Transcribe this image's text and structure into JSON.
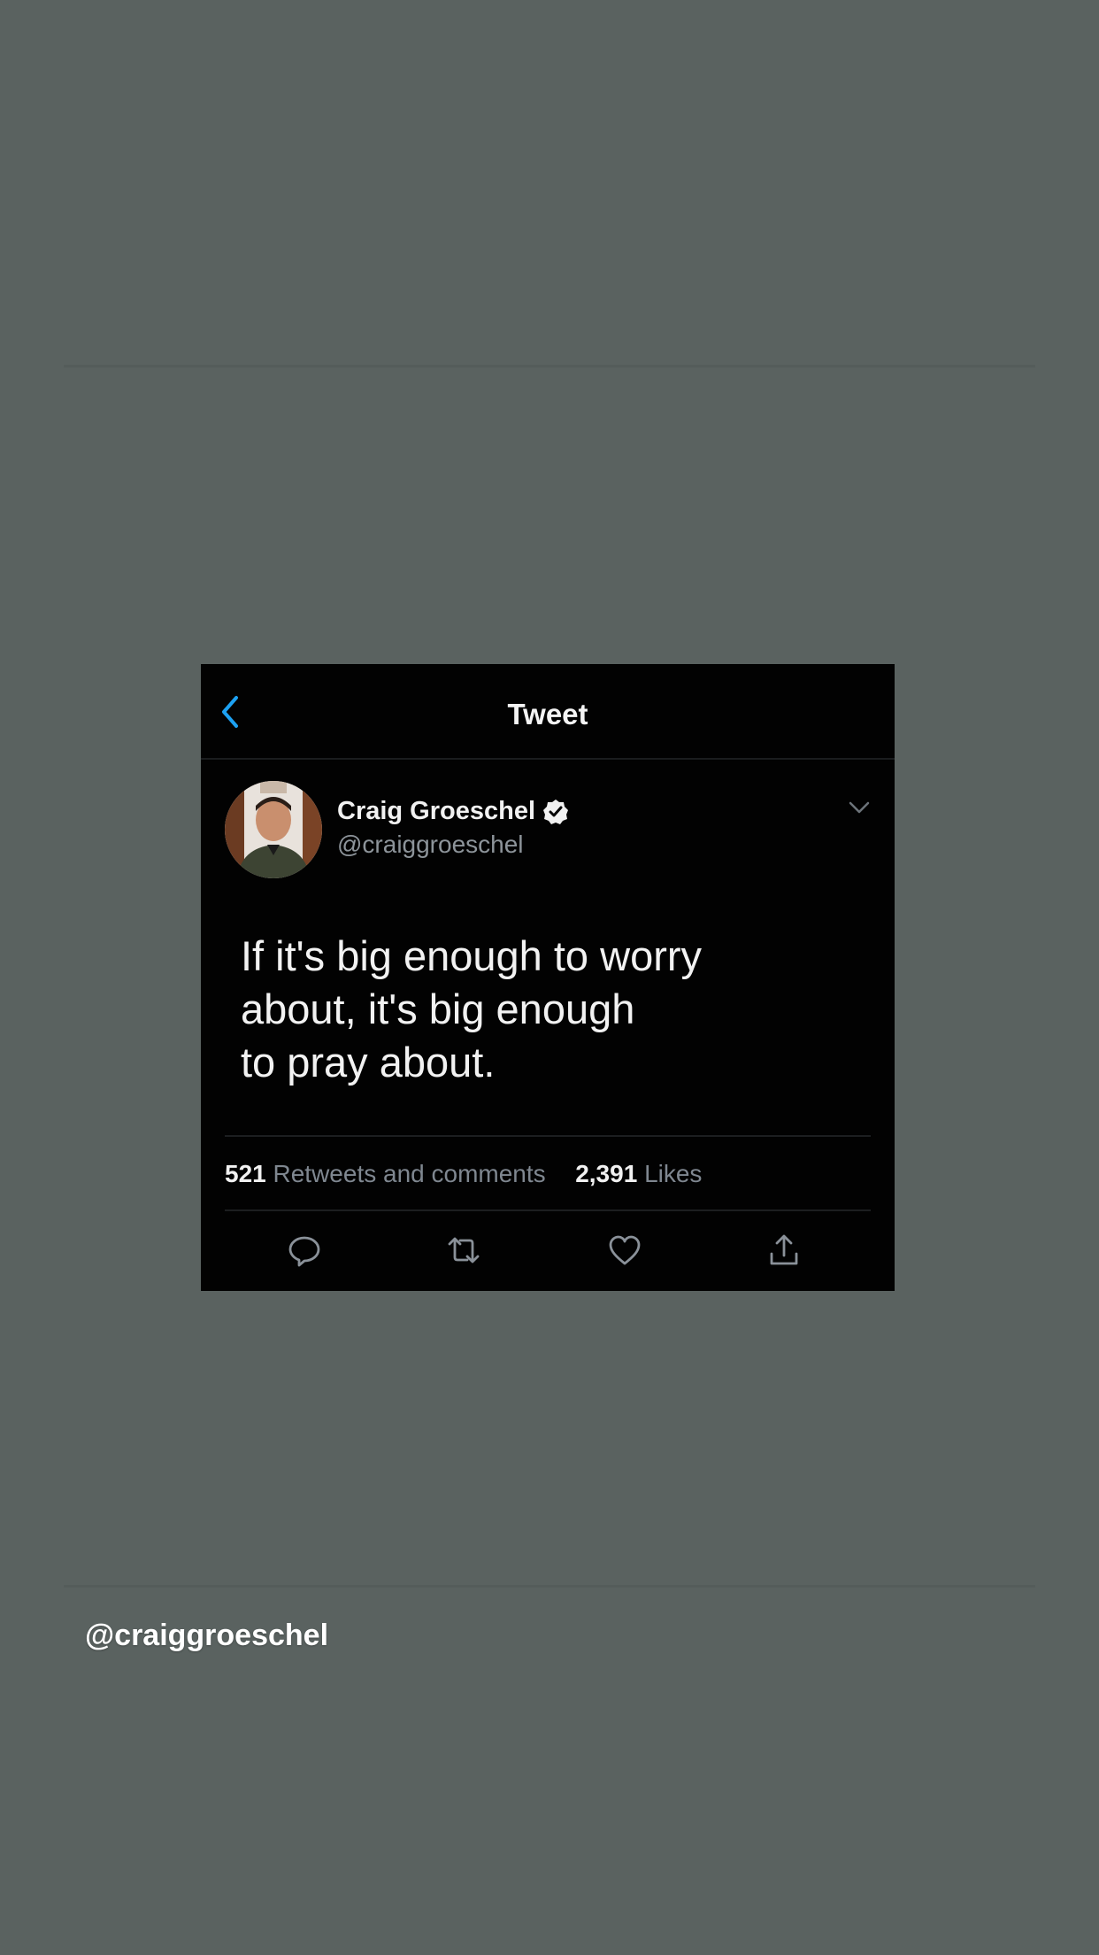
{
  "tweet": {
    "nav_title": "Tweet",
    "author": {
      "name": "Craig Groeschel",
      "handle": "@craiggroeschel",
      "verified": true
    },
    "text_lines": [
      "If it's big enough to worry",
      "about, it's big enough",
      "to pray about."
    ],
    "stats": {
      "retweets_count": "521",
      "retweets_label": "Retweets and comments",
      "likes_count": "2,391",
      "likes_label": "Likes"
    },
    "icons": {
      "back": "chevron-left-icon",
      "verified": "verified-badge-icon",
      "more": "chevron-down-icon",
      "reply": "comment-icon",
      "retweet": "retweet-icon",
      "like": "heart-icon",
      "share": "share-icon"
    },
    "colors": {
      "accent": "#1da1f2",
      "card_bg": "#020202",
      "page_bg": "#5a6260"
    }
  },
  "caption": "@craiggroeschel"
}
